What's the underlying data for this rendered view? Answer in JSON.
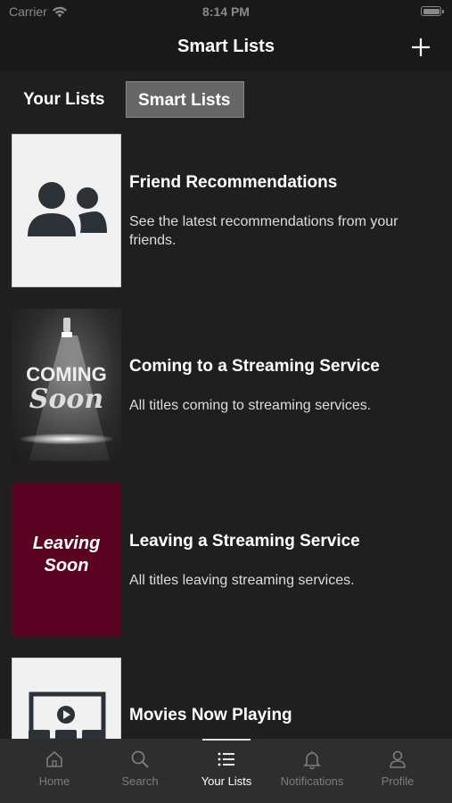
{
  "status_bar": {
    "carrier": "Carrier",
    "time": "8:14 PM"
  },
  "nav": {
    "title": "Smart Lists"
  },
  "segments": [
    {
      "label": "Your Lists",
      "selected": false
    },
    {
      "label": "Smart Lists",
      "selected": true
    }
  ],
  "items": [
    {
      "title": "Friend Recommendations",
      "description": "See the latest recommendations from your friends.",
      "icon": "friends-icon"
    },
    {
      "title": "Coming to a Streaming Service",
      "description": "All titles coming to streaming services.",
      "thumb_text": [
        "COMING",
        "Soon"
      ]
    },
    {
      "title": "Leaving a Streaming Service",
      "description": "All titles leaving streaming services.",
      "thumb_text": [
        "Leaving",
        "Soon"
      ]
    },
    {
      "title": "Movies Now Playing",
      "icon": "movie-screen-icon"
    }
  ],
  "tabs": [
    {
      "label": "Home",
      "icon": "home-icon"
    },
    {
      "label": "Search",
      "icon": "search-icon"
    },
    {
      "label": "Your Lists",
      "icon": "list-icon",
      "active": true
    },
    {
      "label": "Notifications",
      "icon": "bell-icon"
    },
    {
      "label": "Profile",
      "icon": "person-icon"
    }
  ],
  "colors": {
    "background": "#1f1f1f",
    "bar": "#191919",
    "tab_bar": "#2e2e2e",
    "leaving_thumb": "#5b0323",
    "segment_selected": "#666666"
  }
}
